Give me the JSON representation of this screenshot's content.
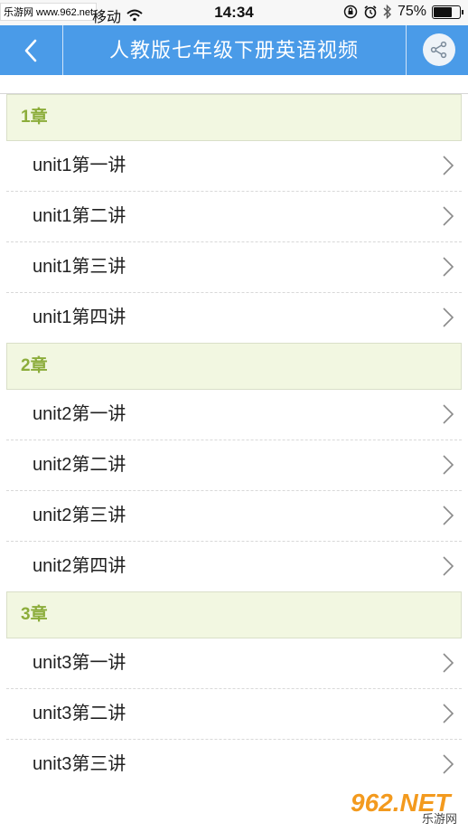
{
  "status_bar": {
    "watermark": "乐游网 www.962.net",
    "carrier": "移动",
    "time": "14:34",
    "battery": "75%",
    "battery_level": 0.75
  },
  "nav": {
    "back_icon": "chevron-left-icon",
    "title": "人教版七年级下册英语视频",
    "share_icon": "share-icon"
  },
  "chapters": [
    {
      "title": "1章",
      "items": [
        "unit1第一讲",
        "unit1第二讲",
        "unit1第三讲",
        "unit1第四讲"
      ]
    },
    {
      "title": "2章",
      "items": [
        "unit2第一讲",
        "unit2第二讲",
        "unit2第三讲",
        "unit2第四讲"
      ]
    },
    {
      "title": "3章",
      "items": [
        "unit3第一讲",
        "unit3第二讲",
        "unit3第三讲"
      ]
    }
  ],
  "watermark_br": {
    "logo": "962.NET",
    "text": "乐游网"
  },
  "colors": {
    "nav_bg": "#4a9be8",
    "chapter_bg": "#f2f7e1",
    "chapter_text": "#8cad3b"
  }
}
